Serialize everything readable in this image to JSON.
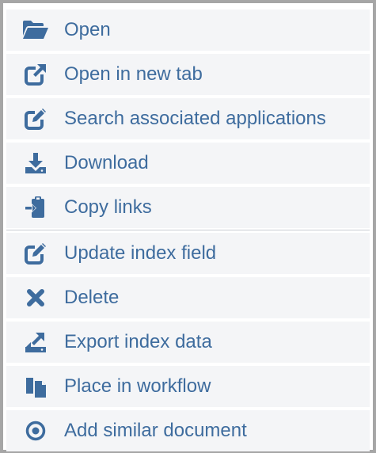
{
  "menu": {
    "items": [
      {
        "label": "Open",
        "icon": "folder-open-icon"
      },
      {
        "label": "Open in new tab",
        "icon": "external-link-icon"
      },
      {
        "label": "Search associated applications",
        "icon": "edit-box-icon"
      },
      {
        "label": "Download",
        "icon": "download-icon"
      },
      {
        "label": "Copy links",
        "icon": "clipboard-link-icon"
      },
      {
        "label": "Update index field",
        "icon": "edit-box-icon"
      },
      {
        "label": "Delete",
        "icon": "close-x-icon"
      },
      {
        "label": "Export index data",
        "icon": "export-icon"
      },
      {
        "label": "Place in workflow",
        "icon": "copy-documents-icon"
      },
      {
        "label": "Add similar document",
        "icon": "dot-circle-icon"
      }
    ]
  },
  "colors": {
    "accent": "#3e6c9e",
    "item_background": "#f4f5f7",
    "border": "#a6a6a6"
  }
}
